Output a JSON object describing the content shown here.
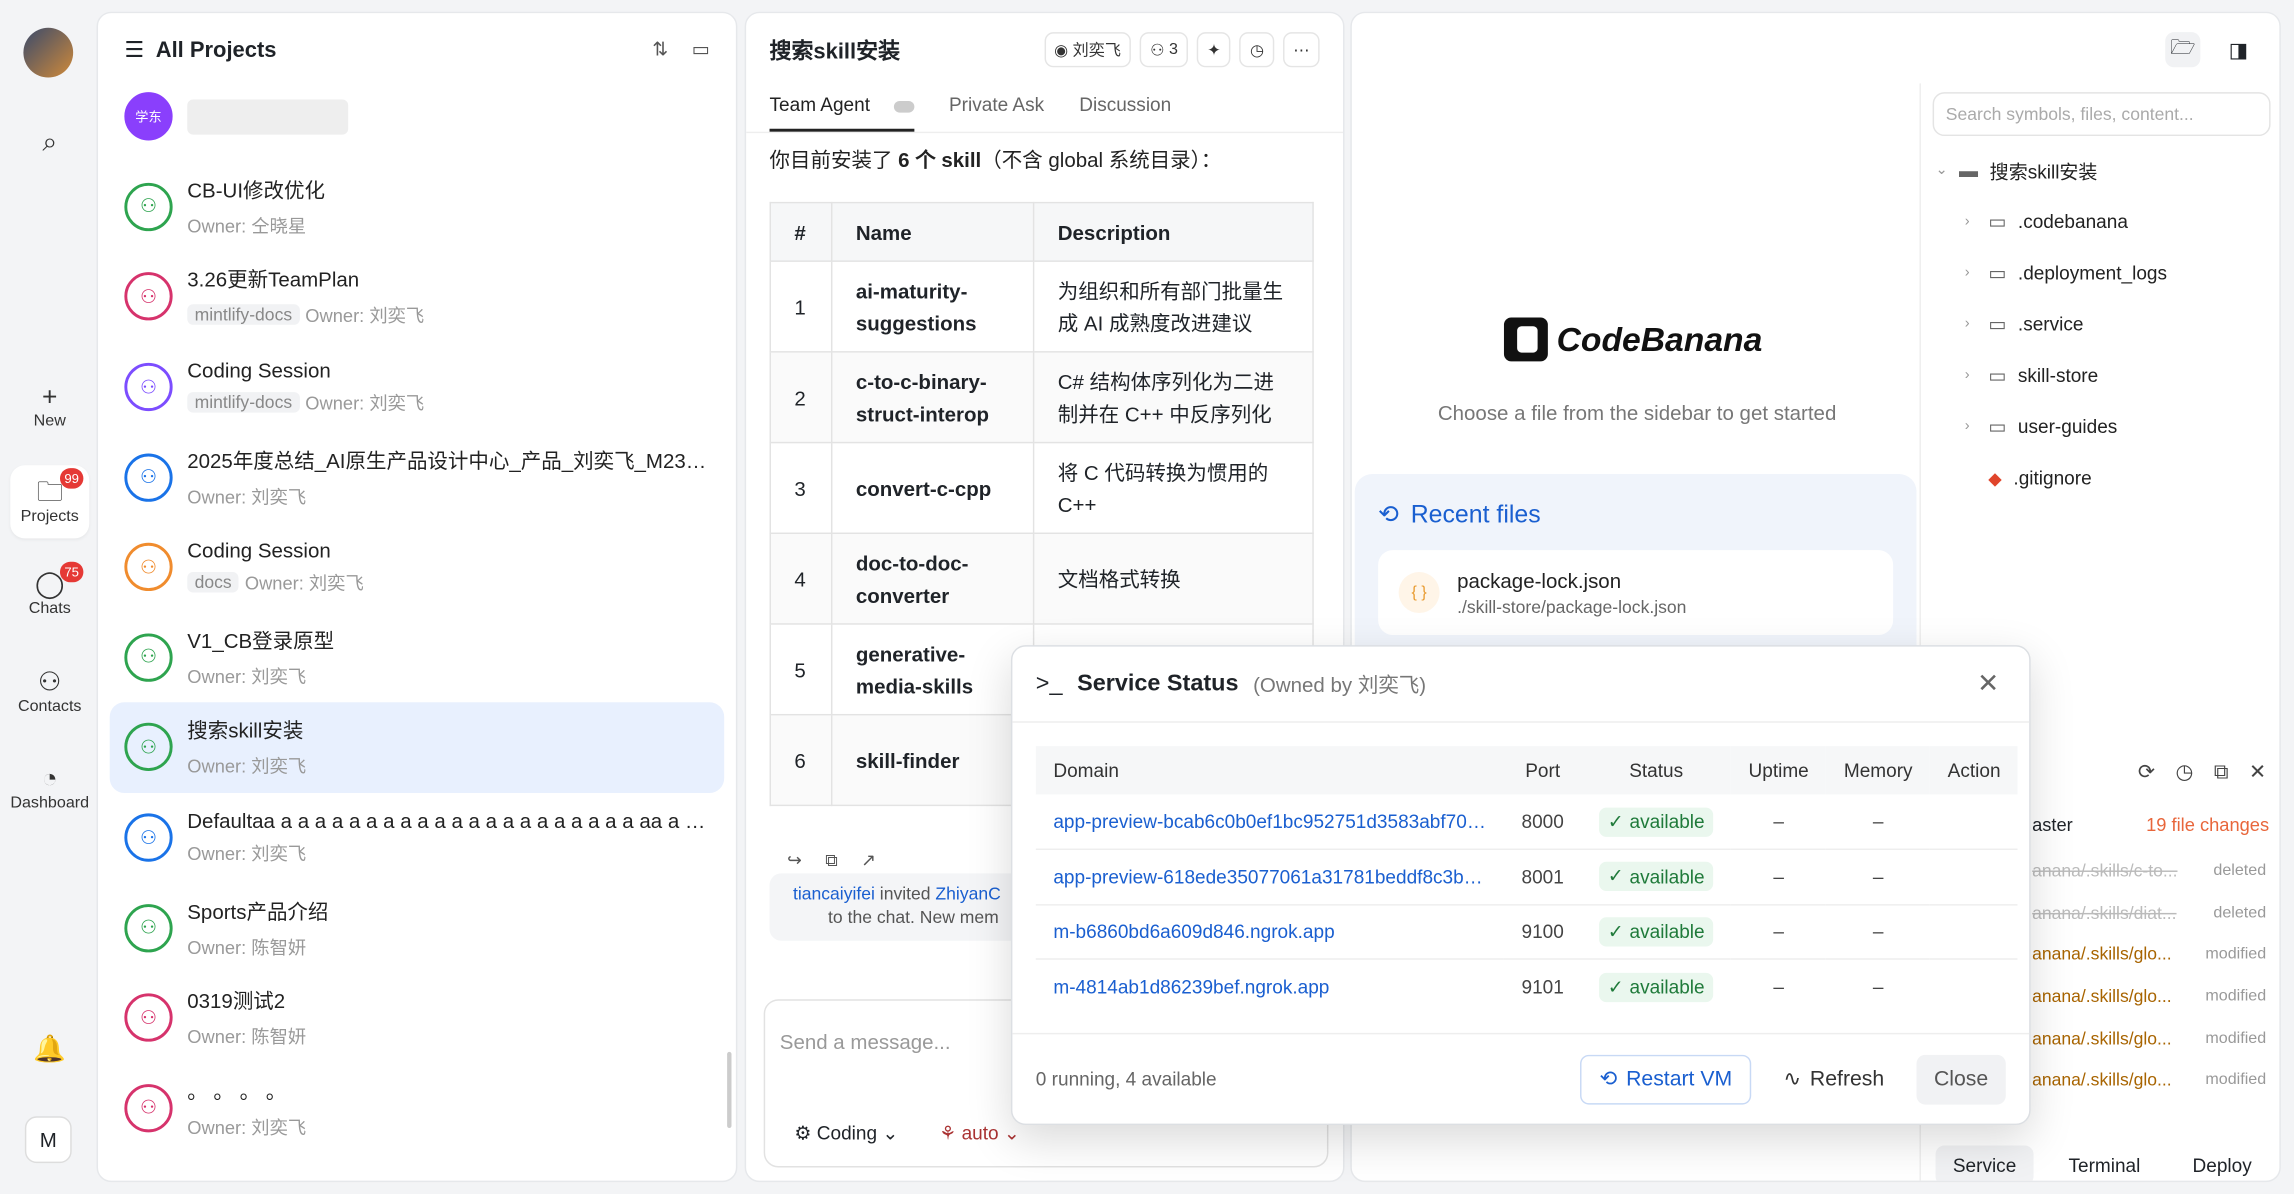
{
  "rail": {
    "new_label": "New",
    "projects_label": "Projects",
    "projects_badge": "99",
    "chats_label": "Chats",
    "chats_badge": "75",
    "contacts_label": "Contacts",
    "dashboard_label": "Dashboard",
    "user_initial": "M"
  },
  "projects": {
    "title": "All Projects",
    "items": [
      {
        "avatar": "学东",
        "name": "",
        "sub_owner": "",
        "tag": ""
      },
      {
        "avatar": "",
        "name": "CB-UI修改优化",
        "sub_owner": "Owner: 仝晓星",
        "tag": ""
      },
      {
        "avatar": "",
        "name": "3.26更新TeamPlan",
        "sub_owner": "Owner: 刘奕飞",
        "tag": "mintlify-docs"
      },
      {
        "avatar": "",
        "name": "Coding Session",
        "sub_owner": "Owner: 刘奕飞",
        "tag": "mintlify-docs"
      },
      {
        "avatar": "",
        "name": "2025年度总结_AI原生产品设计中心_产品_刘奕飞_M2313_...",
        "sub_owner": "Owner: 刘奕飞",
        "tag": ""
      },
      {
        "avatar": "",
        "name": "Coding Session",
        "sub_owner": "Owner: 刘奕飞",
        "tag": "docs"
      },
      {
        "avatar": "",
        "name": "V1_CB登录原型",
        "sub_owner": "Owner: 刘奕飞",
        "tag": ""
      },
      {
        "avatar": "",
        "name": "搜索skill安装",
        "sub_owner": "Owner: 刘奕飞",
        "tag": ""
      },
      {
        "avatar": "",
        "name": "Defaultaa a a a a a a a a a a a a a a a a a a a a a aa a a ...",
        "sub_owner": "Owner: 刘奕飞",
        "tag": ""
      },
      {
        "avatar": "",
        "name": "Sports产品介绍",
        "sub_owner": "Owner: 陈智妍",
        "tag": ""
      },
      {
        "avatar": "",
        "name": "0319测试2",
        "sub_owner": "Owner: 陈智妍",
        "tag": ""
      },
      {
        "avatar": "",
        "name": "。 。 。 。",
        "sub_owner": "Owner: 刘奕飞",
        "tag": ""
      }
    ]
  },
  "chat": {
    "title": "搜索skill安装",
    "owner_btn": "刘奕飞",
    "members_btn": "3",
    "tabs": [
      "Team Agent",
      "Private Ask",
      "Discussion"
    ],
    "intro_pre": "你目前安装了 ",
    "intro_bold": "6 个 skill",
    "intro_post": "（不含 global 系统目录）：",
    "table_headers": [
      "#",
      "Name",
      "Description"
    ],
    "rows": [
      {
        "num": "1",
        "name": "ai-maturity-suggestions",
        "desc": "为组织和所有部门批量生成 AI 成熟度改进建议"
      },
      {
        "num": "2",
        "name": "c-to-c-binary-struct-interop",
        "desc": "C# 结构体序列化为二进制并在 C++ 中反序列化"
      },
      {
        "num": "3",
        "name": "convert-c-cpp",
        "desc": "将 C 代码转换为惯用的 C++"
      },
      {
        "num": "4",
        "name": "doc-to-doc-converter",
        "desc": "文档格式转换"
      },
      {
        "num": "5",
        "name": "generative-media-skills",
        "desc": ""
      },
      {
        "num": "6",
        "name": "skill-finder",
        "desc": ""
      }
    ],
    "sys_user": "tiancaiyifei",
    "sys_invited": " invited ",
    "sys_target": "ZhiyanC",
    "sys_line2": "to the chat. New mem",
    "input_placeholder": "Send a message...",
    "mode_label": "Coding",
    "model_label": "auto"
  },
  "code": {
    "brand": "CodeBanana",
    "choose_text": "Choose a file from the sidebar to get started",
    "recent_title": "Recent files",
    "recent_file": "package-lock.json",
    "recent_path": "./skill-store/package-lock.json",
    "search_placeholder": "Search symbols, files, content...",
    "root": "搜索skill安装",
    "tree": [
      ".codebanana",
      ".deployment_logs",
      ".service",
      "skill-store",
      "user-guides"
    ],
    "gitignore": ".gitignore",
    "branch": "aster",
    "changes_count": "19 file changes",
    "changes": [
      {
        "path": "anana/.skills/c-to...",
        "status": "deleted",
        "kind": "del"
      },
      {
        "path": "anana/.skills/diat...",
        "status": "deleted",
        "kind": "del"
      },
      {
        "path": "anana/.skills/glo...",
        "status": "modified",
        "kind": "mod"
      },
      {
        "path": "anana/.skills/glo...",
        "status": "modified",
        "kind": "mod"
      },
      {
        "path": "anana/.skills/glo...",
        "status": "modified",
        "kind": "mod"
      },
      {
        "path": "anana/.skills/glo...",
        "status": "modified",
        "kind": "mod"
      }
    ],
    "bottom_tabs": [
      "Service",
      "Terminal",
      "Deploy"
    ]
  },
  "modal": {
    "title": "Service Status",
    "owner": "(Owned by 刘奕飞)",
    "headers": [
      "Domain",
      "Port",
      "Status",
      "Uptime",
      "Memory",
      "Action"
    ],
    "rows": [
      {
        "domain": "app-preview-bcab6c0b0ef1bc952751d3583abf7074....",
        "port": "8000",
        "status": "available",
        "uptime": "–",
        "memory": "–"
      },
      {
        "domain": "app-preview-618ede35077061a31781beddf8c3bab9.c...",
        "port": "8001",
        "status": "available",
        "uptime": "–",
        "memory": "–"
      },
      {
        "domain": "m-b6860bd6a609d846.ngrok.app",
        "port": "9100",
        "status": "available",
        "uptime": "–",
        "memory": "–"
      },
      {
        "domain": "m-4814ab1d86239bef.ngrok.app",
        "port": "9101",
        "status": "available",
        "uptime": "–",
        "memory": "–"
      }
    ],
    "summary": "0 running, 4 available",
    "restart_label": "Restart VM",
    "refresh_label": "Refresh",
    "close_label": "Close"
  }
}
